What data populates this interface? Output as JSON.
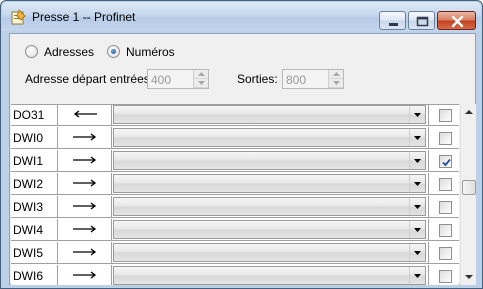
{
  "window": {
    "title": "Presse 1 -- Profinet"
  },
  "mode": {
    "options": [
      {
        "label": "Adresses",
        "selected": false
      },
      {
        "label": "Numéros",
        "selected": true
      }
    ]
  },
  "fields": {
    "start_inputs_label": "Adresse départ entrées:",
    "start_inputs_value": "400",
    "outputs_label": "Sorties:",
    "outputs_value": "800"
  },
  "table": {
    "rows": [
      {
        "name": "DO31",
        "direction": "left",
        "selection": "",
        "checked": false
      },
      {
        "name": "DWI0",
        "direction": "right",
        "selection": "",
        "checked": false
      },
      {
        "name": "DWI1",
        "direction": "right",
        "selection": "",
        "checked": true
      },
      {
        "name": "DWI2",
        "direction": "right",
        "selection": "",
        "checked": false
      },
      {
        "name": "DWI3",
        "direction": "right",
        "selection": "",
        "checked": false
      },
      {
        "name": "DWI4",
        "direction": "right",
        "selection": "",
        "checked": false
      },
      {
        "name": "DWI5",
        "direction": "right",
        "selection": "",
        "checked": false
      },
      {
        "name": "DWI6",
        "direction": "right",
        "selection": "",
        "checked": false
      }
    ]
  },
  "scrollbar": {
    "position": 0.45
  },
  "icons": {
    "app": "application-icon",
    "minimize": "minimize-icon",
    "maximize": "maximize-icon",
    "close": "close-icon"
  }
}
